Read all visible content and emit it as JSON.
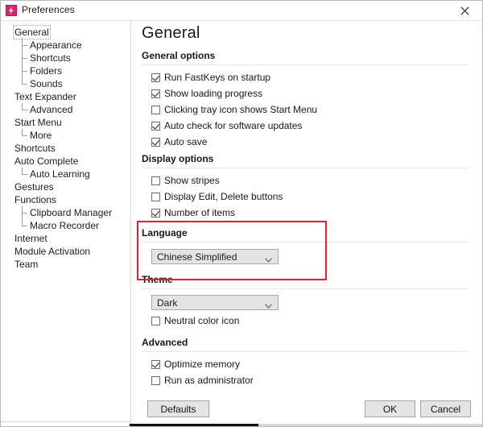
{
  "window": {
    "title": "Preferences",
    "icon": "fastkeys-app-icon",
    "close_label": "close-icon",
    "accent_color": "#e0206a",
    "highlight_color": "#e8222a"
  },
  "sidebar": {
    "items": [
      {
        "label": "General",
        "level": 0,
        "selected": true,
        "connector": "none"
      },
      {
        "label": "Appearance",
        "level": 1,
        "selected": false,
        "connector": "tee"
      },
      {
        "label": "Shortcuts",
        "level": 1,
        "selected": false,
        "connector": "tee"
      },
      {
        "label": "Folders",
        "level": 1,
        "selected": false,
        "connector": "tee"
      },
      {
        "label": "Sounds",
        "level": 1,
        "selected": false,
        "connector": "last"
      },
      {
        "label": "Text Expander",
        "level": 0,
        "selected": false,
        "connector": "none"
      },
      {
        "label": "Advanced",
        "level": 1,
        "selected": false,
        "connector": "last"
      },
      {
        "label": "Start Menu",
        "level": 0,
        "selected": false,
        "connector": "none"
      },
      {
        "label": "More",
        "level": 1,
        "selected": false,
        "connector": "last"
      },
      {
        "label": "Shortcuts",
        "level": 0,
        "selected": false,
        "connector": "none"
      },
      {
        "label": "Auto Complete",
        "level": 0,
        "selected": false,
        "connector": "none"
      },
      {
        "label": "Auto Learning",
        "level": 1,
        "selected": false,
        "connector": "last"
      },
      {
        "label": "Gestures",
        "level": 0,
        "selected": false,
        "connector": "none"
      },
      {
        "label": "Functions",
        "level": 0,
        "selected": false,
        "connector": "none"
      },
      {
        "label": "Clipboard Manager",
        "level": 1,
        "selected": false,
        "connector": "tee"
      },
      {
        "label": "Macro Recorder",
        "level": 1,
        "selected": false,
        "connector": "last"
      },
      {
        "label": "Internet",
        "level": 0,
        "selected": false,
        "connector": "none"
      },
      {
        "label": "Module Activation",
        "level": 0,
        "selected": false,
        "connector": "none"
      },
      {
        "label": "Team",
        "level": 0,
        "selected": false,
        "connector": "none"
      }
    ]
  },
  "page": {
    "title": "General",
    "sections": {
      "general_options": {
        "heading": "General options",
        "checkboxes": [
          {
            "label": "Run FastKeys on startup",
            "checked": true
          },
          {
            "label": "Show loading progress",
            "checked": true
          },
          {
            "label": "Clicking tray icon shows Start Menu",
            "checked": false
          },
          {
            "label": "Auto check for software updates",
            "checked": true
          },
          {
            "label": "Auto save",
            "checked": true
          }
        ]
      },
      "display_options": {
        "heading": "Display options",
        "checkboxes": [
          {
            "label": "Show stripes",
            "checked": false
          },
          {
            "label": "Display Edit, Delete buttons",
            "checked": false
          },
          {
            "label": "Number of items",
            "checked": true
          }
        ]
      },
      "language": {
        "heading": "Language",
        "select_value": "Chinese Simplified",
        "highlighted": true
      },
      "theme": {
        "heading": "Theme",
        "select_value": "Dark",
        "checkboxes": [
          {
            "label": "Neutral color icon",
            "checked": false
          }
        ]
      },
      "advanced": {
        "heading": "Advanced",
        "checkboxes": [
          {
            "label": "Optimize memory",
            "checked": true
          },
          {
            "label": "Run as administrator",
            "checked": false
          }
        ]
      }
    }
  },
  "footer": {
    "defaults_label": "Defaults",
    "ok_label": "OK",
    "cancel_label": "Cancel"
  }
}
